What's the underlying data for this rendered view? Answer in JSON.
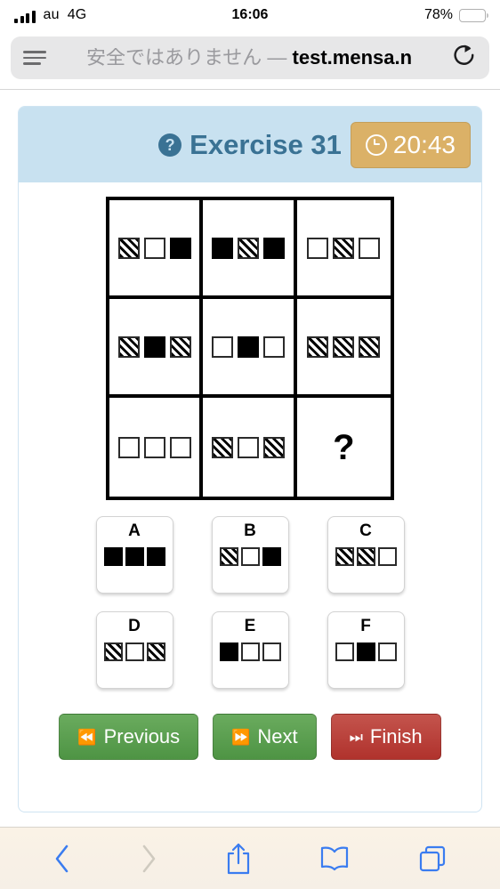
{
  "status_bar": {
    "carrier": "au",
    "network": "4G",
    "time": "16:06",
    "battery_percent": "78%",
    "battery_level": 78,
    "signal_bars": 4,
    "signal_icon": "signal-bars-icon",
    "battery_icon": "battery-icon"
  },
  "browser": {
    "reader_icon": "reader-view-icon",
    "security_warning": "安全ではありません",
    "separator": "—",
    "host": "test.mensa.n",
    "reload_icon": "reload-icon",
    "toolbar": {
      "back_icon": "back-chevron-icon",
      "forward_icon": "forward-chevron-icon",
      "share_icon": "share-icon",
      "bookmarks_icon": "bookmarks-book-icon",
      "tabs_icon": "tabs-icon"
    }
  },
  "exercise": {
    "help_icon": "question-mark-circle-icon",
    "title": "Exercise 31",
    "timer": "20:43",
    "clock_icon": "clock-icon",
    "header_bg": "#c8e1f0",
    "title_color": "#3a7294",
    "timer_bg": "#dbb167"
  },
  "matrix": {
    "question_mark": "?",
    "cells": [
      {
        "id": "r1c1",
        "shapes": [
          "hatch",
          "white",
          "black"
        ]
      },
      {
        "id": "r1c2",
        "shapes": [
          "black",
          "hatch",
          "black"
        ]
      },
      {
        "id": "r1c3",
        "shapes": [
          "white",
          "hatch",
          "white"
        ]
      },
      {
        "id": "r2c1",
        "shapes": [
          "hatch",
          "black",
          "hatch"
        ]
      },
      {
        "id": "r2c2",
        "shapes": [
          "white",
          "black",
          "white"
        ]
      },
      {
        "id": "r2c3",
        "shapes": [
          "hatch",
          "hatch",
          "hatch"
        ]
      },
      {
        "id": "r3c1",
        "shapes": [
          "white",
          "white",
          "white"
        ]
      },
      {
        "id": "r3c2",
        "shapes": [
          "hatch",
          "white",
          "hatch"
        ]
      },
      {
        "id": "r3c3",
        "shapes": []
      }
    ]
  },
  "options": [
    {
      "label": "A",
      "shapes": [
        "black",
        "black",
        "black"
      ]
    },
    {
      "label": "B",
      "shapes": [
        "hatch",
        "white",
        "black"
      ]
    },
    {
      "label": "C",
      "shapes": [
        "hatch",
        "hatch",
        "white"
      ]
    },
    {
      "label": "D",
      "shapes": [
        "hatch",
        "white",
        "hatch"
      ]
    },
    {
      "label": "E",
      "shapes": [
        "black",
        "white",
        "white"
      ]
    },
    {
      "label": "F",
      "shapes": [
        "white",
        "black",
        "white"
      ]
    }
  ],
  "buttons": {
    "previous": {
      "label": "Previous",
      "icon": "⏪",
      "color": "#4e9444"
    },
    "next": {
      "label": "Next",
      "icon": "⏩",
      "color": "#4e9444"
    },
    "finish": {
      "label": "Finish",
      "icon": "⏭",
      "color": "#b0322c"
    }
  }
}
